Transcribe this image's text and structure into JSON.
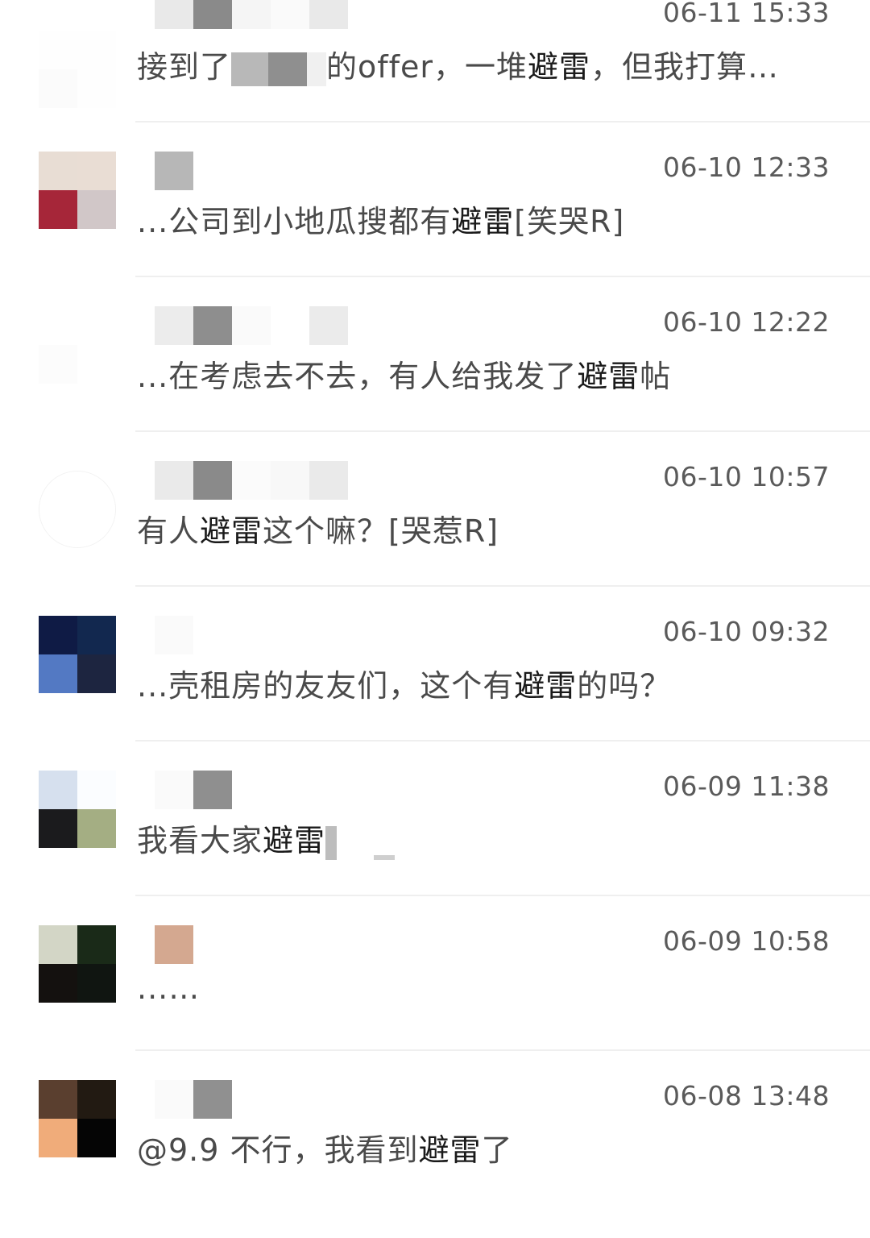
{
  "comments": [
    {
      "time": "06-11 15:33",
      "msg_before": "接到了",
      "msg_mid": "的offer，一堆",
      "keyword": "避雷",
      "msg_after": "，但我打算…",
      "avatar_colors": [
        "#fefefe",
        "#fefefe",
        "#fbfbfb",
        "#fefefe"
      ]
    },
    {
      "time": "06-10 12:33",
      "msg_before": "...公司到小地瓜搜都有",
      "keyword": "避雷",
      "msg_after": "[笑哭R]",
      "avatar_colors": [
        "#e8ddd4",
        "#e9ddd4",
        "#a62639",
        "#d1c7c8"
      ]
    },
    {
      "time": "06-10 12:22",
      "msg_before": "...在考虑去不去，有人给我发了",
      "keyword": "避雷",
      "msg_after": "帖",
      "avatar_colors": [
        "#ffffff",
        "#ffffff",
        "#fcfcfc",
        "#ffffff"
      ]
    },
    {
      "time": "06-10 10:57",
      "msg_before": "有人",
      "keyword": "避雷",
      "msg_after": "这个嘛？[哭惹R]",
      "avatar_colors": [
        "#ffffff",
        "#ffffff",
        "#ffffff",
        "#ffffff"
      ]
    },
    {
      "time": "06-10 09:32",
      "msg_before": "...壳租房的友友们，这个有",
      "keyword": "避雷",
      "msg_after": "的吗？",
      "avatar_colors": [
        "#0f1b45",
        "#12284f",
        "#5379c3",
        "#1d2540"
      ]
    },
    {
      "time": "06-09 11:38",
      "msg_before": "我看大家",
      "keyword": "避雷",
      "msg_after": "",
      "avatar_colors": [
        "#d6e0ee",
        "#fbfdff",
        "#1b1b1d",
        "#a4ae83"
      ]
    },
    {
      "time": "06-09 10:58",
      "msg_before": "...…",
      "keyword": "",
      "msg_after": "",
      "avatar_colors": [
        "#d3d6c6",
        "#1a2a18",
        "#14110f",
        "#101511"
      ]
    },
    {
      "time": "06-08 13:48",
      "msg_before": "@9.9 不行，我看到",
      "keyword": "避雷",
      "msg_after": "了",
      "avatar_colors": [
        "#5a3f2f",
        "#221a12",
        "#f0ac7a",
        "#050505"
      ]
    }
  ]
}
